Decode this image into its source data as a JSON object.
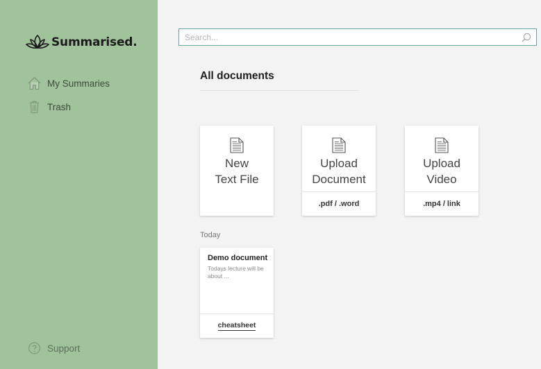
{
  "app": {
    "name": "Summarised."
  },
  "sidebar": {
    "items": [
      {
        "label": "My Summaries",
        "icon": "home-icon"
      },
      {
        "label": "Trash",
        "icon": "trash-icon"
      }
    ],
    "support": {
      "label": "Support",
      "icon": "help-circle-icon"
    }
  },
  "search": {
    "placeholder": "Search...",
    "value": ""
  },
  "main": {
    "title": "All documents",
    "actions": [
      {
        "title": "New\nText File",
        "subtitle": "",
        "icon": "document-icon"
      },
      {
        "title": "Upload\nDocument",
        "subtitle": ".pdf / .word",
        "icon": "document-icon"
      },
      {
        "title": "Upload\nVideo",
        "subtitle": ".mp4 / link",
        "icon": "document-icon"
      }
    ],
    "sections": [
      {
        "label": "Today",
        "documents": [
          {
            "title": "Demo document",
            "snippet": "Todays lecture will be about ...",
            "tag": "cheatsheet"
          }
        ]
      }
    ]
  },
  "colors": {
    "sidebar_bg": "#a1c39b",
    "content_bg": "#f3f3f3",
    "search_border": "#6aa4a6"
  }
}
